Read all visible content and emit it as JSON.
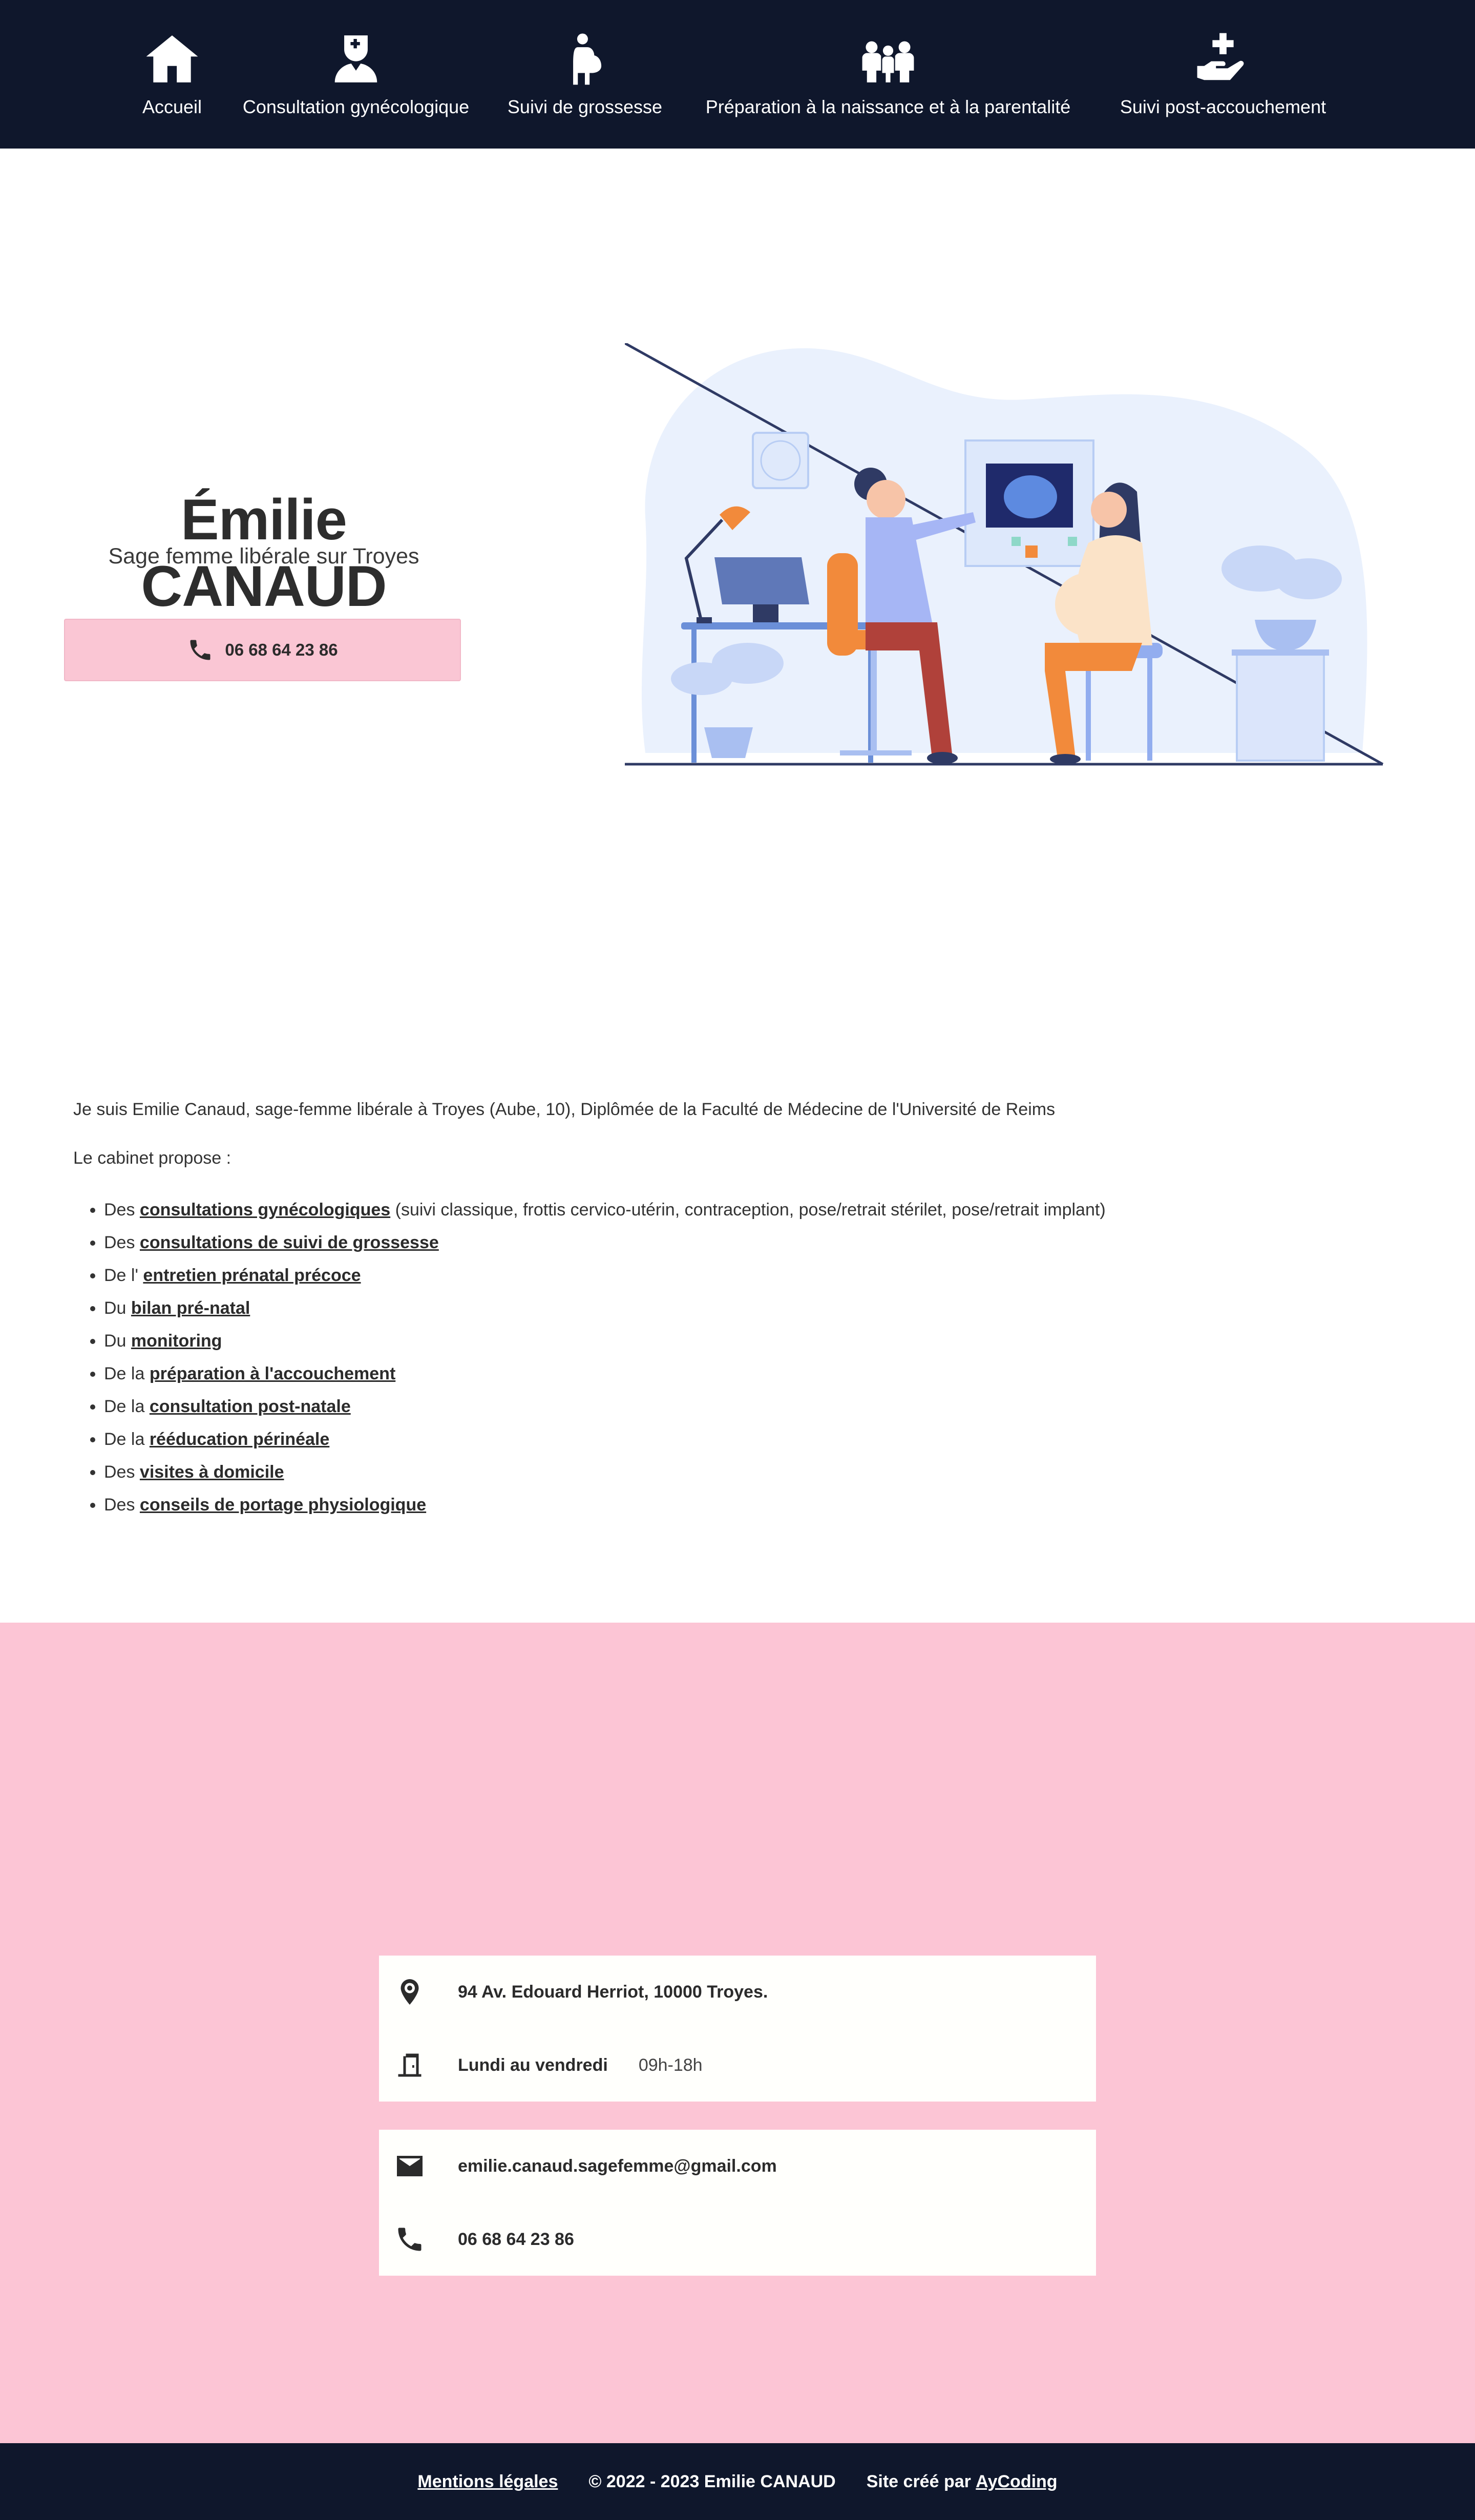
{
  "nav": {
    "items": [
      {
        "label": "Accueil",
        "icon": "home-icon"
      },
      {
        "label": "Consultation gynécologique",
        "icon": "nurse-icon"
      },
      {
        "label": "Suivi de grossesse",
        "icon": "pregnant-woman-icon"
      },
      {
        "label": "Préparation à la naissance et à la parentalité",
        "icon": "family-icon"
      },
      {
        "label": "Suivi post-accouchement",
        "icon": "hand-holding-medical-icon"
      }
    ]
  },
  "hero": {
    "title": "Émilie CANAUD",
    "subtitle": "Sage femme libérale sur Troyes",
    "phone_button": "06 68 64 23 86"
  },
  "content": {
    "intro": "Je suis Emilie Canaud, sage-femme libérale à Troyes (Aube, 10), Diplômée de la Faculté de Médecine de l'Université de Reims",
    "propose": "Le cabinet propose :",
    "services": [
      {
        "prefix": "Des ",
        "link": "consultations gynécologiques",
        "suffix": " (suivi classique, frottis cervico-utérin, contraception, pose/retrait stérilet, pose/retrait implant)"
      },
      {
        "prefix": "Des ",
        "link": "consultations de suivi de grossesse",
        "suffix": ""
      },
      {
        "prefix": "De l' ",
        "link": "entretien prénatal précoce",
        "suffix": ""
      },
      {
        "prefix": "Du ",
        "link": "bilan pré-natal",
        "suffix": ""
      },
      {
        "prefix": "Du ",
        "link": "monitoring",
        "suffix": ""
      },
      {
        "prefix": "De la ",
        "link": "préparation à l'accouchement",
        "suffix": ""
      },
      {
        "prefix": "De la ",
        "link": "consultation post-natale",
        "suffix": ""
      },
      {
        "prefix": "De la ",
        "link": "rééducation périnéale",
        "suffix": ""
      },
      {
        "prefix": "Des ",
        "link": "visites à domicile",
        "suffix": ""
      },
      {
        "prefix": "Des ",
        "link": "conseils de portage physiologique",
        "suffix": ""
      }
    ]
  },
  "contact": {
    "address": "94 Av. Edouard Herriot, 10000 Troyes.",
    "days": "Lundi au vendredi",
    "hours": "09h-18h",
    "email": "emilie.canaud.sagefemme@gmail.com",
    "phone": "06 68 64 23 86"
  },
  "footer": {
    "legal": "Mentions légales",
    "copyright": "© 2022 - 2023 Emilie CANAUD",
    "credit_prefix": "Site créé par ",
    "credit_link": "AyCoding"
  },
  "colors": {
    "nav_bg": "#0f172c",
    "pink": "#fcc5d5",
    "button_pink": "#fac6d4"
  }
}
